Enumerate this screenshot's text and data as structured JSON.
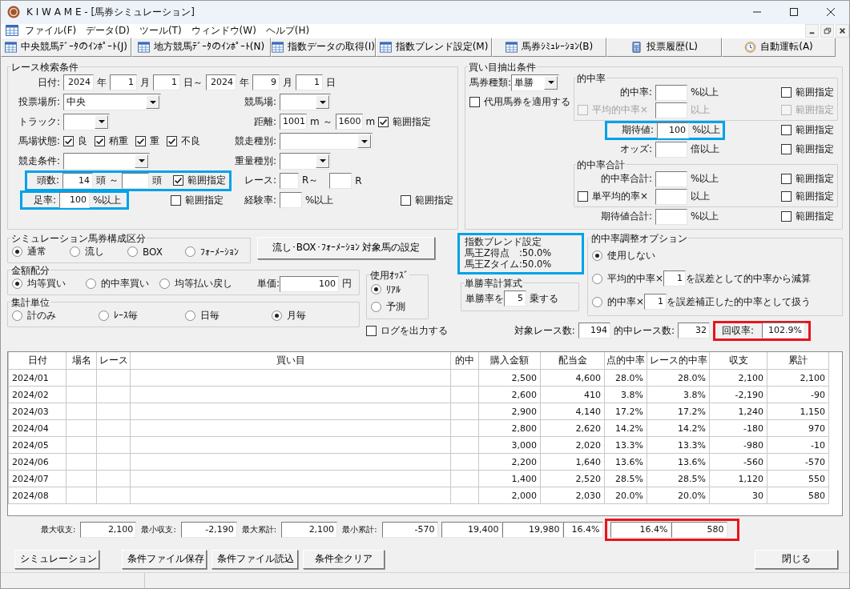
{
  "window": {
    "title": "K I W A M E - [馬券シミュレーション]"
  },
  "menu": [
    "ファイル(F)",
    "データ(D)",
    "ツール(T)",
    "ウィンドウ(W)",
    "ヘルプ(H)"
  ],
  "toolbar": [
    {
      "label": "中央競馬ﾃﾞｰﾀのｲﾝﾎﾟｰﾄ(J)",
      "kind": "table"
    },
    {
      "label": "地方競馬ﾃﾞｰﾀのｲﾝﾎﾟｰﾄ(N)",
      "kind": "table"
    },
    {
      "label": "指数データの取得(I)",
      "kind": "table"
    },
    {
      "label": "指数ブレンド設定(M)",
      "kind": "table"
    },
    {
      "label": "馬券ｼﾐｭﾚｰｼｮﾝ(B)",
      "kind": "table"
    },
    {
      "label": "投票履歴(L)",
      "kind": "calculator"
    },
    {
      "label": "自動運転(A)",
      "kind": "clock"
    }
  ],
  "race_search": {
    "title": "レース検索条件",
    "date": {
      "label": "日付:",
      "fields": [
        "2024",
        "1",
        "1",
        "2024",
        "9",
        "1"
      ],
      "units": [
        "年",
        "月",
        "日～",
        "年",
        "月",
        "日"
      ]
    },
    "venue": {
      "label": "投票場所:",
      "value": "中央"
    },
    "racecourse": {
      "label": "競馬場:"
    },
    "track": {
      "label": "トラック:"
    },
    "distance": {
      "label": "距離:",
      "from": "1001",
      "unit_from": "m ～",
      "to": "1600",
      "unit_to": "m",
      "range": {
        "label": "範囲指定",
        "checked": true
      }
    },
    "track_condition": {
      "label": "馬場状態:",
      "options": [
        {
          "label": "良",
          "checked": true
        },
        {
          "label": "稍重",
          "checked": true
        },
        {
          "label": "重",
          "checked": true
        },
        {
          "label": "不良",
          "checked": true
        }
      ]
    },
    "race_type": {
      "label": "競走種別:"
    },
    "race_condition": {
      "label": "競走条件:"
    },
    "weight_type": {
      "label": "重量種別:"
    },
    "runners": {
      "label": "頭数:",
      "from": "14",
      "unit_from": "頭 ～",
      "unit_to": "頭",
      "range": {
        "label": "範囲指定",
        "checked": true
      },
      "highlight": {
        "color": "#00a2e8"
      }
    },
    "race_no": {
      "label": "レース:",
      "unit_from": "R～",
      "unit_to": "R"
    },
    "fill_rate": {
      "label": "足率:",
      "value": "100",
      "unit": "%以上",
      "highlight": {
        "color": "#00a2e8"
      },
      "range": {
        "label": "範囲指定",
        "checked": false
      }
    },
    "experience": {
      "label": "経験率:",
      "unit": "%以上",
      "range": {
        "label": "範囲指定",
        "checked": false
      }
    }
  },
  "bet_conditions": {
    "title": "買い目抽出条件",
    "ticket_type": {
      "label": "馬券種類:",
      "value": "単勝"
    },
    "substitute": {
      "label": "代用馬券を適用する",
      "checked": false
    },
    "hit_rate_group": {
      "title": "的中率",
      "hit_rate": {
        "label": "的中率:",
        "unit": "%以上",
        "range": {
          "label": "範囲指定",
          "checked": false,
          "disabled": false
        }
      },
      "avg_hit_rate": {
        "label": "平均的中率×",
        "checked": false,
        "disabled": true,
        "unit": "以上",
        "range": {
          "label": "範囲指定",
          "checked": false,
          "disabled": true
        }
      }
    },
    "expected_value": {
      "label": "期待値:",
      "value": "100",
      "unit": "%以上",
      "highlight": {
        "color": "#00a2e8"
      },
      "range": {
        "label": "範囲指定",
        "checked": false
      }
    },
    "odds": {
      "label": "オッズ:",
      "unit": "倍以上",
      "range": {
        "label": "範囲指定",
        "checked": false
      }
    },
    "hit_total_group": {
      "title": "的中率合計",
      "hit_total": {
        "label": "的中率合計:",
        "unit": "%以上",
        "range": {
          "label": "範囲指定",
          "checked": false
        }
      },
      "single_avg": {
        "label": "単平均的率×",
        "checked": false,
        "unit": "以上",
        "range": {
          "label": "範囲指定",
          "checked": false
        }
      }
    },
    "expected_total": {
      "label": "期待値合計:",
      "unit": "%以上",
      "range": {
        "label": "範囲指定",
        "checked": false
      }
    }
  },
  "composition": {
    "title": "シミュレーション馬券構成区分",
    "options": [
      {
        "label": "通常",
        "selected": true
      },
      {
        "label": "流し",
        "selected": false
      },
      {
        "label": "BOX",
        "selected": false
      },
      {
        "label": "ﾌｫｰﾒｰｼｮﾝ",
        "selected": false
      }
    ]
  },
  "target_button": "流し･BOX･ﾌｫｰﾒｰｼｮﾝ 対象馬の設定",
  "amount": {
    "title": "金額配分",
    "options": [
      {
        "label": "均等買い",
        "selected": true
      },
      {
        "label": "的中率買い",
        "selected": false
      },
      {
        "label": "均等払い戻し",
        "selected": false
      }
    ],
    "unit_price_label": "単価:",
    "unit_price": "100",
    "currency": "円"
  },
  "odds_used": {
    "title": "使用ｵｯｽﾞ",
    "options": [
      {
        "label": "ﾘｱﾙ",
        "selected": true
      },
      {
        "label": "予測",
        "selected": false
      }
    ]
  },
  "aggregation": {
    "title": "集計単位",
    "options": [
      {
        "label": "計のみ",
        "selected": false
      },
      {
        "label": "ﾚｰｽ毎",
        "selected": false
      },
      {
        "label": "日毎",
        "selected": false
      },
      {
        "label": "月毎",
        "selected": true
      }
    ]
  },
  "log_output": {
    "label": "ログを出力する",
    "checked": false
  },
  "blend": {
    "title": "指数ブレンド設定",
    "lines": [
      "馬王Z得点　:50.0%",
      "馬王Zタイム:50.0%"
    ],
    "highlight": {
      "color": "#00a2e8"
    }
  },
  "win_rate": {
    "title": "単勝率計算式",
    "prefix": "単勝率を",
    "value": "5",
    "suffix": "乗する"
  },
  "adjust": {
    "title": "的中率調整オプション",
    "options": [
      {
        "label": "使用しない",
        "selected": true
      },
      {
        "before": "平均的中率×",
        "value": "1",
        "after": "を誤差として的中率から減算",
        "selected": false
      },
      {
        "before": "的中率×",
        "value": "1",
        "after": "を誤差補正した的中率として扱う",
        "selected": false
      }
    ]
  },
  "summary": {
    "target_races_label": "対象レース数:",
    "target_races": "194",
    "hit_races_label": "的中レース数:",
    "hit_races": "32",
    "recovery_label": "回収率:",
    "recovery": "102.9%",
    "highlight": {
      "color": "#e8141c"
    }
  },
  "table": {
    "columns": [
      "日付",
      "場名",
      "レース",
      "買い目",
      "的中",
      "購入金額",
      "配当金",
      "点的中率",
      "レース的中率",
      "収支",
      "累計"
    ],
    "rows": [
      {
        "date": "2024/01",
        "purchase": "2,500",
        "payout": "4,600",
        "point_hit": "28.0%",
        "race_hit": "28.0%",
        "income": "2,100",
        "cumulative": "2,100"
      },
      {
        "date": "2024/02",
        "purchase": "2,600",
        "payout": "410",
        "point_hit": "3.8%",
        "race_hit": "3.8%",
        "income": "-2,190",
        "cumulative": "-90"
      },
      {
        "date": "2024/03",
        "purchase": "2,900",
        "payout": "4,140",
        "point_hit": "17.2%",
        "race_hit": "17.2%",
        "income": "1,240",
        "cumulative": "1,150"
      },
      {
        "date": "2024/04",
        "purchase": "2,800",
        "payout": "2,620",
        "point_hit": "14.2%",
        "race_hit": "14.2%",
        "income": "-180",
        "cumulative": "970"
      },
      {
        "date": "2024/05",
        "purchase": "3,000",
        "payout": "2,020",
        "point_hit": "13.3%",
        "race_hit": "13.3%",
        "income": "-980",
        "cumulative": "-10"
      },
      {
        "date": "2024/06",
        "purchase": "2,200",
        "payout": "1,640",
        "point_hit": "13.6%",
        "race_hit": "13.6%",
        "income": "-560",
        "cumulative": "-570"
      },
      {
        "date": "2024/07",
        "purchase": "1,400",
        "payout": "2,520",
        "point_hit": "28.5%",
        "race_hit": "28.5%",
        "income": "1,120",
        "cumulative": "550"
      },
      {
        "date": "2024/08",
        "purchase": "2,000",
        "payout": "2,030",
        "point_hit": "20.0%",
        "race_hit": "20.0%",
        "income": "30",
        "cumulative": "580"
      }
    ]
  },
  "totals": {
    "max_income_label": "最大収支:",
    "max_income": "2,100",
    "min_income_label": "最小収支:",
    "min_income": "-2,190",
    "max_cum_label": "最大累計:",
    "max_cum": "2,100",
    "min_cum_label": "最小累計:",
    "min_cum": "-570",
    "purchase": "19,400",
    "payout": "19,980",
    "point_hit": "16.4%",
    "race_hit": "16.4%",
    "income": "580",
    "highlight": {
      "color": "#e8141c"
    }
  },
  "buttons": [
    "シミュレーション",
    "条件ファイル保存",
    "条件ファイル読込",
    "条件全クリア"
  ],
  "close_button": "閉じる"
}
